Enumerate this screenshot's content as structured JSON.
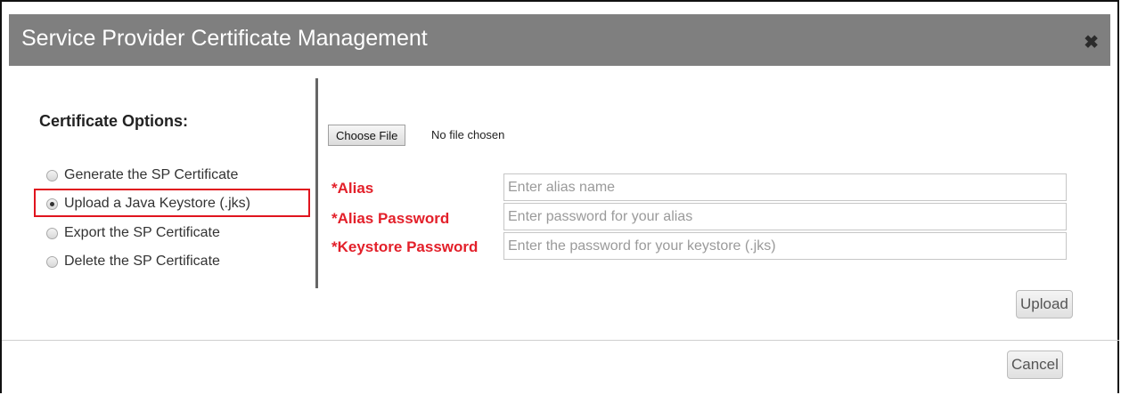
{
  "dialog": {
    "title": "Service Provider Certificate Management",
    "close_icon": "close-icon",
    "close_glyph": "✖"
  },
  "options": {
    "heading": "Certificate Options:",
    "items": [
      {
        "label": "Generate the SP Certificate",
        "checked": false
      },
      {
        "label": "Upload a Java Keystore (.jks)",
        "checked": true
      },
      {
        "label": "Export the SP Certificate",
        "checked": false
      },
      {
        "label": "Delete the SP Certificate",
        "checked": false
      }
    ]
  },
  "upload": {
    "choose_file_label": "Choose File",
    "file_status": "No file chosen",
    "fields": [
      {
        "label": "*Alias",
        "placeholder": "Enter alias name"
      },
      {
        "label": "*Alias Password",
        "placeholder": "Enter password for your alias"
      },
      {
        "label": "*Keystore Password",
        "placeholder": "Enter the password for your keystore (.jks)"
      }
    ],
    "upload_label": "Upload"
  },
  "footer": {
    "cancel_label": "Cancel"
  },
  "colors": {
    "titlebar": "#7f7f7f",
    "required_label": "#e3202a",
    "selection_highlight": "#e0141e"
  }
}
